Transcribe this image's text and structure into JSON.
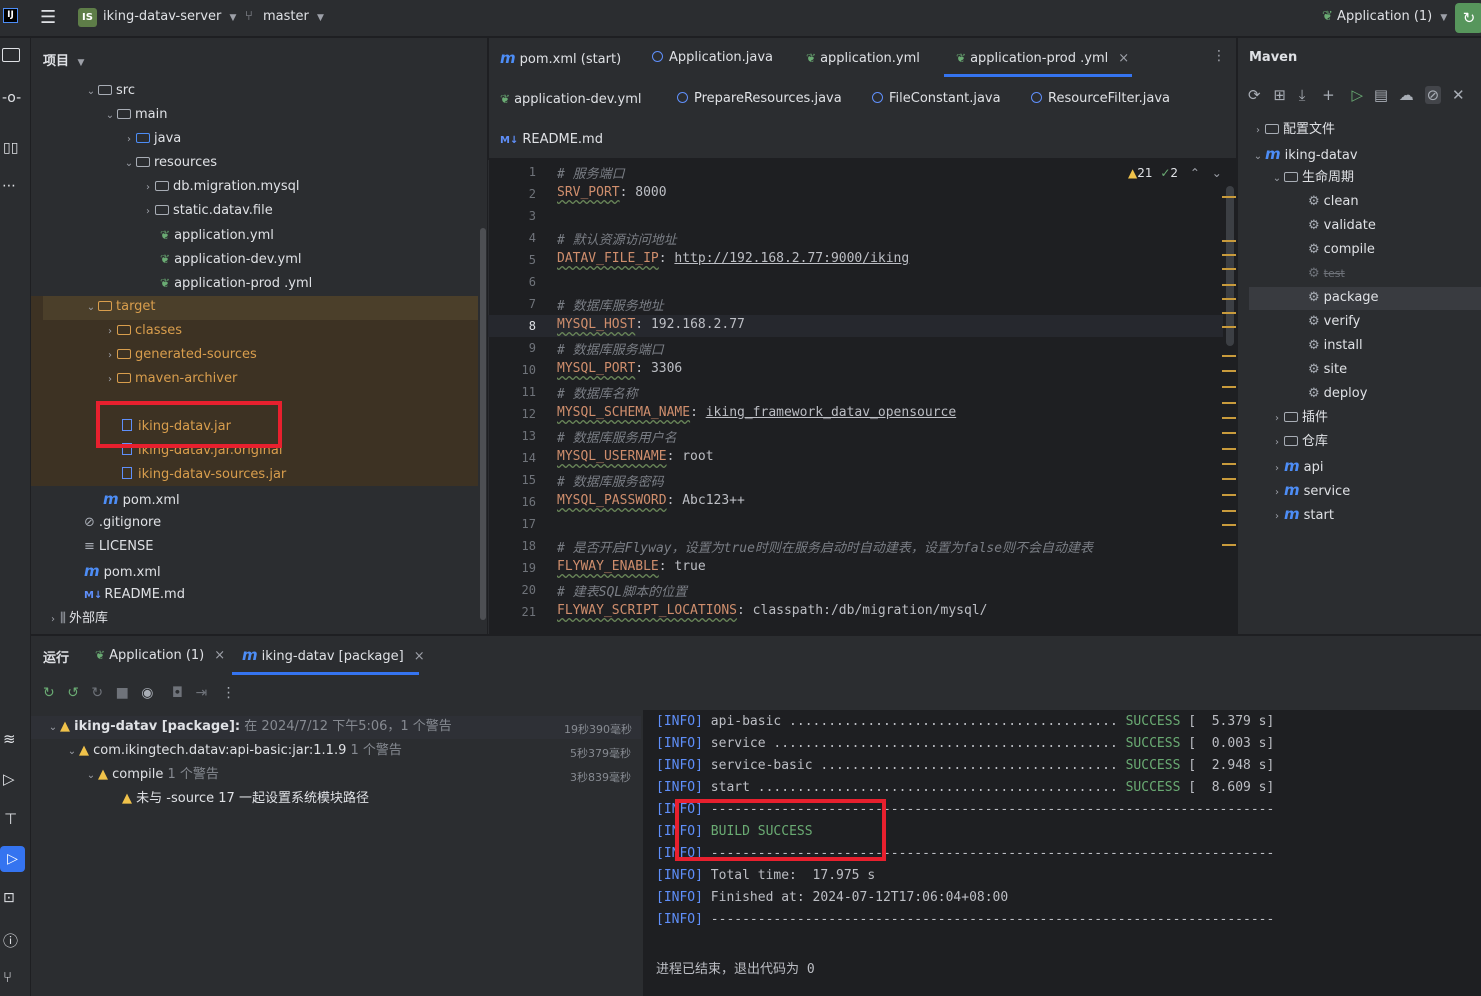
{
  "titlebar": {
    "project_badge": "IS",
    "project_name": "iking-datav-server",
    "branch": "master",
    "run_config": "Application (1)"
  },
  "project_panel": {
    "title": "项目",
    "tree": [
      {
        "label": "src"
      },
      {
        "label": "main"
      },
      {
        "label": "java"
      },
      {
        "label": "resources"
      },
      {
        "label": "db.migration.mysql"
      },
      {
        "label": "static.datav.file"
      },
      {
        "label": "application.yml"
      },
      {
        "label": "application-dev.yml"
      },
      {
        "label": "application-prod .yml"
      },
      {
        "label": "target"
      },
      {
        "label": "classes"
      },
      {
        "label": "generated-sources"
      },
      {
        "label": "maven-archiver"
      },
      {
        "label": "iking-datav.jar"
      },
      {
        "label": "iking-datav.jar.original"
      },
      {
        "label": "iking-datav-sources.jar"
      },
      {
        "label": "pom.xml"
      },
      {
        "label": ".gitignore"
      },
      {
        "label": "LICENSE"
      },
      {
        "label": "pom.xml"
      },
      {
        "label": "README.md"
      },
      {
        "label": "外部库"
      }
    ]
  },
  "editor_tabs": {
    "row1": [
      "pom.xml (start)",
      "Application.java",
      "application.yml",
      "application-prod .yml"
    ],
    "row2": [
      "application-dev.yml",
      "PrepareResources.java",
      "FileConstant.java",
      "ResourceFilter.java"
    ],
    "row3": [
      "README.md"
    ],
    "warnings": "21",
    "checks": "2"
  },
  "code_lines": [
    {
      "n": "1",
      "comment": "# 服务端口"
    },
    {
      "n": "2",
      "key": "SRV_PORT",
      "value": "8000"
    },
    {
      "n": "3"
    },
    {
      "n": "4",
      "comment": "# 默认资源访问地址"
    },
    {
      "n": "5",
      "key": "DATAV_FILE_IP",
      "value": "http://192.168.2.77:9000/iking"
    },
    {
      "n": "6"
    },
    {
      "n": "7",
      "comment": "# 数据库服务地址"
    },
    {
      "n": "8",
      "key": "MYSQL_HOST",
      "value": "192.168.2.77"
    },
    {
      "n": "9",
      "comment": "# 数据库服务端口"
    },
    {
      "n": "10",
      "key": "MYSQL_PORT",
      "value": "3306"
    },
    {
      "n": "11",
      "comment": "# 数据库名称"
    },
    {
      "n": "12",
      "key": "MYSQL_SCHEMA_NAME",
      "value": "iking_framework_datav_opensource"
    },
    {
      "n": "13",
      "comment": "# 数据库服务用户名"
    },
    {
      "n": "14",
      "key": "MYSQL_USERNAME",
      "value": "root"
    },
    {
      "n": "15",
      "comment": "# 数据库服务密码"
    },
    {
      "n": "16",
      "key": "MYSQL_PASSWORD",
      "value": "Abc123++"
    },
    {
      "n": "17"
    },
    {
      "n": "18",
      "comment": "# 是否开启Flyway，设置为true时则在服务启动时自动建表，设置为false则不会自动建表"
    },
    {
      "n": "19",
      "key": "FLYWAY_ENABLE",
      "value": "true"
    },
    {
      "n": "20",
      "comment": "# 建表SQL脚本的位置"
    },
    {
      "n": "21",
      "key": "FLYWAY_SCRIPT_LOCATIONS",
      "value": "classpath:/db/migration/mysql/"
    }
  ],
  "maven": {
    "title": "Maven",
    "items": [
      "配置文件",
      "iking-datav",
      "生命周期",
      "clean",
      "validate",
      "compile",
      "test",
      "package",
      "verify",
      "install",
      "site",
      "deploy",
      "插件",
      "仓库",
      "api",
      "service",
      "start"
    ]
  },
  "run_panel": {
    "title": "运行",
    "tabs": [
      "Application (1)",
      "iking-datav [package]"
    ],
    "tree": [
      {
        "label": "iking-datav [package]:",
        "detail": "在 2024/7/12 下午5:06，1 个警告",
        "time": "19秒390毫秒"
      },
      {
        "label": "com.ikingtech.datav:api-basic:jar:1.1.9",
        "detail": "1 个警告",
        "time": "5秒379毫秒"
      },
      {
        "label": "compile",
        "detail": "1 个警告",
        "time": "3秒839毫秒"
      },
      {
        "label": "未与 -source 17 一起设置系统模块路径",
        "detail": "",
        "time": ""
      }
    ],
    "console": [
      {
        "tag": "[INFO]",
        "text": " api-basic .......................................... ",
        "status": "SUCCESS",
        "tail": " [  5.379 s]"
      },
      {
        "tag": "[INFO]",
        "text": " service ............................................ ",
        "status": "SUCCESS",
        "tail": " [  0.003 s]"
      },
      {
        "tag": "[INFO]",
        "text": " service-basic ...................................... ",
        "status": "SUCCESS",
        "tail": " [  2.948 s]"
      },
      {
        "tag": "[INFO]",
        "text": " start .............................................. ",
        "status": "SUCCESS",
        "tail": " [  8.609 s]"
      },
      {
        "tag": "[INFO]",
        "text": " ------------------------------------------------------------------------",
        "status": "",
        "tail": ""
      },
      {
        "tag": "[INFO]",
        "text": " ",
        "status": "BUILD SUCCESS",
        "tail": ""
      },
      {
        "tag": "[INFO]",
        "text": " ------------------------------------------------------------------------",
        "status": "",
        "tail": ""
      },
      {
        "tag": "[INFO]",
        "text": " Total time:  17.975 s",
        "status": "",
        "tail": ""
      },
      {
        "tag": "[INFO]",
        "text": " Finished at: 2024-07-12T17:06:04+08:00",
        "status": "",
        "tail": ""
      },
      {
        "tag": "[INFO]",
        "text": " ------------------------------------------------------------------------",
        "status": "",
        "tail": ""
      }
    ],
    "exit_message": "进程已结束，退出代码为 0"
  }
}
